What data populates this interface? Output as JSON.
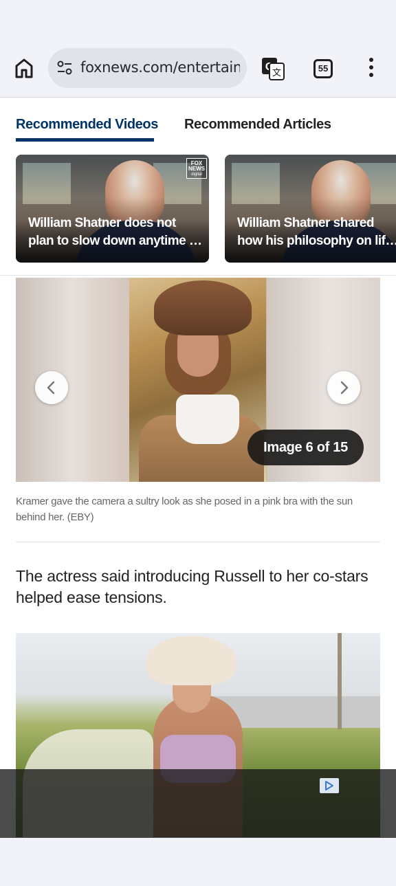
{
  "browser": {
    "url": "foxnews.com/entertainment",
    "tab_count": "55",
    "icons": [
      "home-icon",
      "site-settings-icon",
      "translate-icon",
      "tab-switcher-icon",
      "more-vert-icon"
    ]
  },
  "recommended": {
    "tabs": [
      {
        "label": "Recommended Videos",
        "active": true
      },
      {
        "label": "Recommended Articles",
        "active": false
      }
    ],
    "videos": [
      {
        "title_line1": "William Shatner does not",
        "title_line2": "plan to slow down anytime soon",
        "logo_line1": "FOX",
        "logo_line2": "NEWS",
        "logo_line3": "digital"
      },
      {
        "title_line1": "William Shatner shared",
        "title_line2": "how his philosophy on life has changed"
      }
    ]
  },
  "gallery": {
    "counter": "Image 6 of 15",
    "caption": "Kramer gave the camera a sultry look as she posed in a pink bra with the sun behind her. (EBY)"
  },
  "article": {
    "paragraph": "The actress said introducing Russell to her co-stars helped ease tensions."
  },
  "colors": {
    "accent": "#003366",
    "browser_bg": "#f2f3f8",
    "url_pill": "#e1e3ea"
  }
}
